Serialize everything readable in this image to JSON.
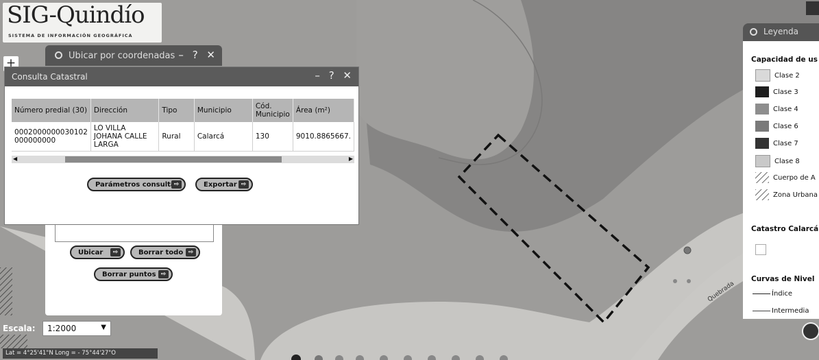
{
  "logo": {
    "title": "SIG-Quindío",
    "subtitle": "SISTEMA DE INFORMACIÓN GEOGRÁFICA"
  },
  "coord_panel": {
    "title": "Ubicar por coordenadas",
    "controls": "– ? ✕",
    "buttons": {
      "ubicar": "Ubicar",
      "borrar_todo": "Borrar todo",
      "borrar_puntos": "Borrar puntos"
    }
  },
  "consulta": {
    "title": "Consulta Catastral",
    "controls": "– ? ✕",
    "columns": [
      "Número predial (30)",
      "Dirección",
      "Tipo",
      "Municipio",
      "Cód. Municipio",
      "Área (m²)"
    ],
    "rows": [
      [
        "0002000000030102 000000000",
        "LO VILLA JOHANA CALLE LARGA",
        "Rural",
        "Calarcá",
        "130",
        "9010.8865667."
      ]
    ],
    "buttons": {
      "parametros": "Parámetros consulta",
      "exportar": "Exportar"
    }
  },
  "legend": {
    "title": "Leyenda",
    "sections": [
      {
        "title": "Capacidad de us",
        "items": [
          {
            "label": "Clase 2",
            "color": "#d9d9d9"
          },
          {
            "label": "Clase 3",
            "color": "#1e1e1e"
          },
          {
            "label": "Clase 4",
            "color": "#8e8e8e"
          },
          {
            "label": "Clase 6",
            "color": "#7a7a7a"
          },
          {
            "label": "Clase 7",
            "color": "#333333"
          },
          {
            "label": "Clase 8",
            "color": "#c9c9c9"
          },
          {
            "label": "Cuerpo de A",
            "color": "hatch"
          },
          {
            "label": "Zona Urbana",
            "color": "hatch"
          }
        ]
      },
      {
        "title": "Catastro Calarcá",
        "items": []
      },
      {
        "title": "Curvas de Nivel",
        "items": [
          {
            "label": "Índice",
            "color": "line"
          },
          {
            "label": "Intermedia",
            "color": "line"
          }
        ]
      }
    ]
  },
  "scale": {
    "label": "Escala:",
    "value": "1:2000"
  },
  "coordinates": "Lat = 4°25'41\"N Long = - 75°44'27\"O",
  "map_label": "Quebrada"
}
